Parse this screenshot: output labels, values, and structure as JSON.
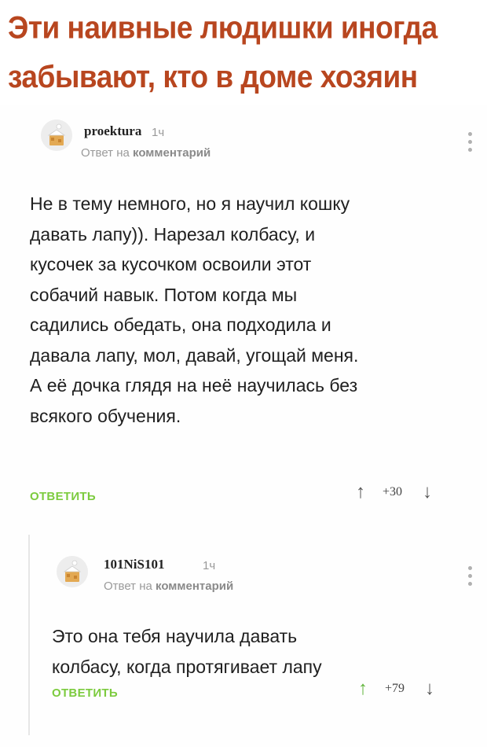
{
  "headline": [
    "Эти наивные людишки иногда",
    "забывают, кто в доме хозяин"
  ],
  "comments": [
    {
      "username": "proektura",
      "time": "1ч",
      "reply_to_prefix": "Ответ на",
      "reply_to_target": "комментарий",
      "body": [
        "Не в тему немного, но я научил кошку",
        "давать лапу)). Нарезал колбасу, и",
        "кусочек за кусочком освоили этот",
        "собачий навык. Потом когда мы",
        "садились обедать, она подходила и",
        "давала лапу, мол, давай, угощай меня.",
        "А её дочка глядя на неё научилась без",
        "всякого обучения."
      ],
      "reply_label": "ОТВЕТИТЬ",
      "score": "+30"
    },
    {
      "username": "101NiS101",
      "time": "1ч",
      "reply_to_prefix": "Ответ на",
      "reply_to_target": "комментарий",
      "body": [
        "Это она тебя научила давать",
        "колбасу, когда протягивает лапу"
      ],
      "reply_label": "ОТВЕТИТЬ",
      "score": "+79"
    }
  ],
  "icons": {
    "avatar": "default-avatar-icon",
    "more": "more-vertical-icon",
    "upvote": "arrow-up-icon",
    "downvote": "arrow-down-icon"
  },
  "colors": {
    "headline": "#b8461f",
    "reply_button": "#7ccb3e",
    "upvote_active": "#5fb43a"
  }
}
